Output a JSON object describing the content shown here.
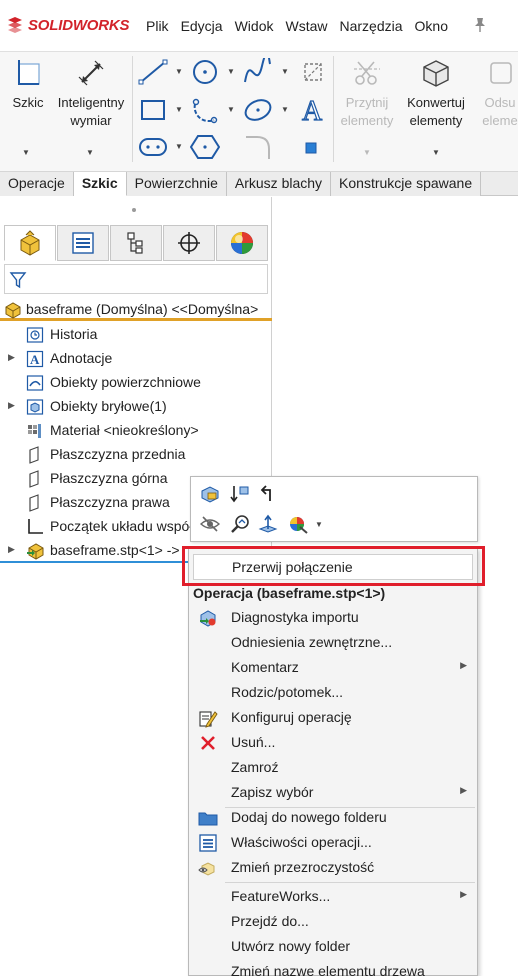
{
  "app": {
    "logo_text": "SOLIDWORKS"
  },
  "menu": [
    "Plik",
    "Edycja",
    "Widok",
    "Wstaw",
    "Narzędzia",
    "Okno"
  ],
  "ribbon": {
    "sketch": "Szkic",
    "smart_dim_1": "Inteligentny",
    "smart_dim_2": "wymiar",
    "trim_1": "Przytnij",
    "trim_2": "elementy",
    "convert_1": "Konwertuj",
    "convert_2": "elementy",
    "offset_1": "Odsu",
    "offset_2": "eleme"
  },
  "tabs": [
    "Operacje",
    "Szkic",
    "Powierzchnie",
    "Arkusz blachy",
    "Konstrukcje spawane"
  ],
  "active_tab": "Szkic",
  "tree": {
    "root": "baseframe  (Domyślna) <<Domyślna>",
    "items": [
      "Historia",
      "Adnotacje",
      "Obiekty powierzchniowe",
      "Obiekty bryłowe(1)",
      "Materiał <nieokreślony>",
      "Płaszczyzna przednia",
      "Płaszczyzna górna",
      "Płaszczyzna prawa",
      "Początek układu współrzędnych",
      "baseframe.stp<1> ->"
    ]
  },
  "context_menu": {
    "first": "Przerwij połączenie",
    "header": "Operacja (baseframe.stp<1>)",
    "items": [
      "Diagnostyka importu",
      "Odniesienia zewnętrzne...",
      "Komentarz",
      "Rodzic/potomek...",
      "Konfiguruj operację",
      "Usuń...",
      "Zamroź",
      "Zapisz wybór",
      "Dodaj do nowego folderu",
      "Właściwości operacji...",
      "Zmień przezroczystość",
      "FeatureWorks...",
      "Przejdź do...",
      "Utwórz nowy folder",
      "Zmień nazwę elementu drzewa"
    ]
  },
  "colors": {
    "accent_red": "#d2232a",
    "highlight_box": "#e01e2b",
    "root_underline": "#e0a128",
    "selection": "#2f8fd7"
  }
}
